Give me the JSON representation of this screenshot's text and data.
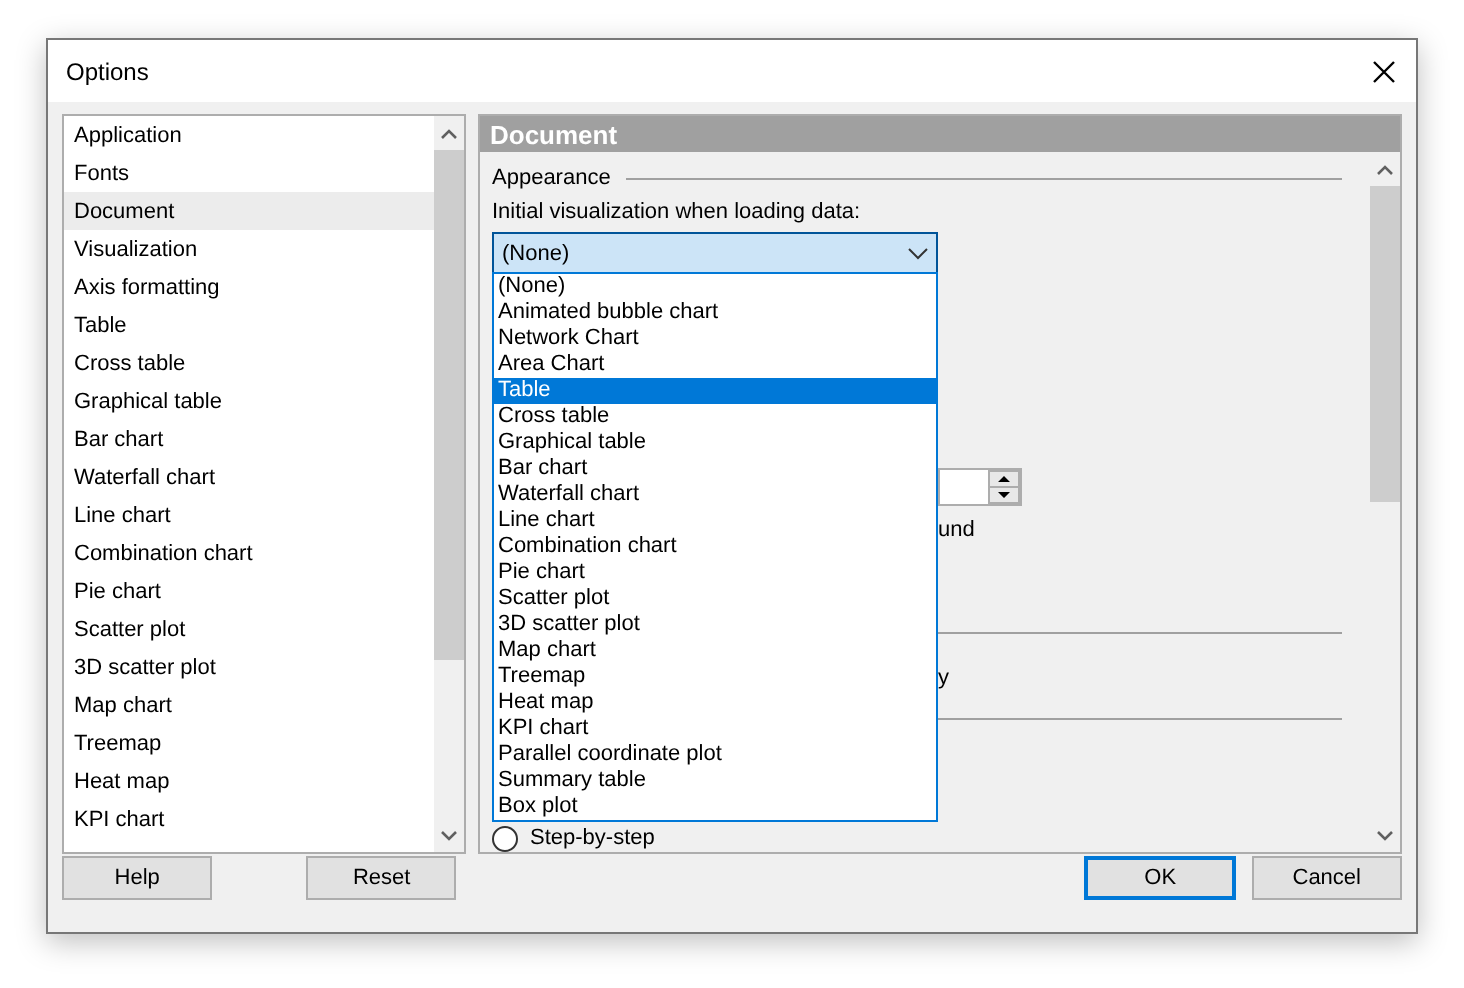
{
  "window": {
    "title": "Options"
  },
  "sidebar": {
    "items": [
      {
        "label": "Application",
        "selected": false
      },
      {
        "label": "Fonts",
        "selected": false
      },
      {
        "label": "Document",
        "selected": true
      },
      {
        "label": "Visualization",
        "selected": false
      },
      {
        "label": "Axis formatting",
        "selected": false
      },
      {
        "label": "Table",
        "selected": false
      },
      {
        "label": "Cross table",
        "selected": false
      },
      {
        "label": "Graphical table",
        "selected": false
      },
      {
        "label": "Bar chart",
        "selected": false
      },
      {
        "label": "Waterfall chart",
        "selected": false
      },
      {
        "label": "Line chart",
        "selected": false
      },
      {
        "label": "Combination chart",
        "selected": false
      },
      {
        "label": "Pie chart",
        "selected": false
      },
      {
        "label": "Scatter plot",
        "selected": false
      },
      {
        "label": "3D scatter plot",
        "selected": false
      },
      {
        "label": "Map chart",
        "selected": false
      },
      {
        "label": "Treemap",
        "selected": false
      },
      {
        "label": "Heat map",
        "selected": false
      },
      {
        "label": "KPI chart",
        "selected": false
      }
    ]
  },
  "panel": {
    "title": "Document",
    "group": "Appearance",
    "field_label": "Initial visualization when loading data:",
    "combo_value": "(None)",
    "options": [
      {
        "label": "(None)",
        "selected": false
      },
      {
        "label": "Animated bubble chart",
        "selected": false
      },
      {
        "label": "Network Chart",
        "selected": false
      },
      {
        "label": "Area Chart",
        "selected": false
      },
      {
        "label": "Table",
        "selected": true
      },
      {
        "label": "Cross table",
        "selected": false
      },
      {
        "label": "Graphical table",
        "selected": false
      },
      {
        "label": "Bar chart",
        "selected": false
      },
      {
        "label": "Waterfall chart",
        "selected": false
      },
      {
        "label": "Line chart",
        "selected": false
      },
      {
        "label": "Combination chart",
        "selected": false
      },
      {
        "label": "Pie chart",
        "selected": false
      },
      {
        "label": "Scatter plot",
        "selected": false
      },
      {
        "label": "3D scatter plot",
        "selected": false
      },
      {
        "label": "Map chart",
        "selected": false
      },
      {
        "label": "Treemap",
        "selected": false
      },
      {
        "label": "Heat map",
        "selected": false
      },
      {
        "label": "KPI chart",
        "selected": false
      },
      {
        "label": "Parallel coordinate plot",
        "selected": false
      },
      {
        "label": "Summary table",
        "selected": false
      },
      {
        "label": "Box plot",
        "selected": false
      }
    ],
    "hidden_text_1": "und",
    "hidden_text_2": "y",
    "radio": {
      "label": "Step-by-step",
      "selected": false
    }
  },
  "buttons": [
    {
      "label": "Help",
      "kind": "plain"
    },
    {
      "label": "Reset",
      "kind": "plain"
    },
    {
      "label": "OK",
      "kind": "default"
    },
    {
      "label": "Cancel",
      "kind": "plain"
    }
  ]
}
